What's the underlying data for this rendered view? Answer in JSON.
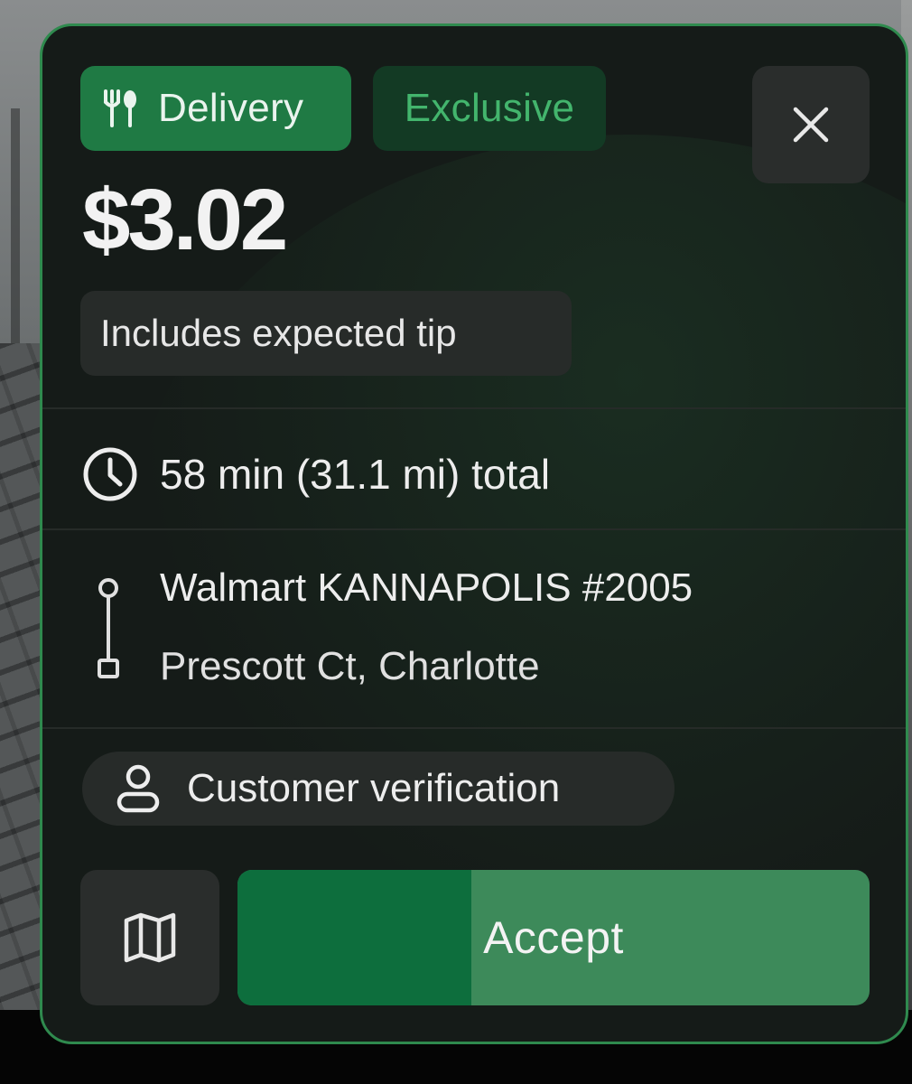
{
  "offer": {
    "type_label": "Delivery",
    "exclusive_label": "Exclusive",
    "price": "$3.02",
    "tip_note": "Includes expected tip",
    "trip_summary": "58 min (31.1 mi) total",
    "pickup": "Walmart KANNAPOLIS #2005",
    "dropoff": "Prescott Ct, Charlotte",
    "requirement": "Customer verification",
    "accept_label": "Accept",
    "accept_timer_progress": 0.37
  },
  "icons": {
    "type": "fork-knife-icon",
    "close": "close-icon",
    "time": "clock-icon",
    "route": "route-icon",
    "requirement": "person-icon",
    "map": "map-icon"
  },
  "colors": {
    "border": "#2f8a4e",
    "delivery_chip": "#1f7a44",
    "exclusive_chip": "#133a24",
    "exclusive_text": "#43b56d",
    "accept_fill": "#0d6e3d",
    "accept_remaining": "#3d8a5a",
    "card_bg": "#151b18"
  }
}
